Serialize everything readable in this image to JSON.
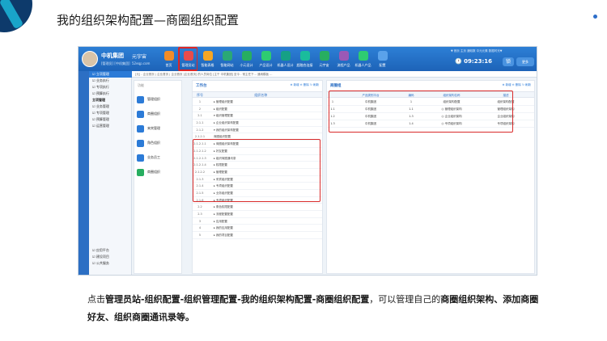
{
  "slide": {
    "title": "我的组织架构配置—商圈组织配置",
    "caption_parts": [
      {
        "text": "点击",
        "bold": false
      },
      {
        "text": "管理员站-组织配置-组织管理配置-我的组织架构配置-商圈组织配置",
        "bold": true
      },
      {
        "text": "，可以管理自己的",
        "bold": false
      },
      {
        "text": "商圈组织架构、添加商圈好友、组织商圈通讯录等。",
        "bold": true
      }
    ]
  },
  "colors": {
    "accent_blue": "#1d63b8",
    "highlight_red": "#d92b2b"
  },
  "app": {
    "org_name": "中机集团",
    "org_sub": "[管理员] [中机集团]",
    "space_name": "元宇宙",
    "space_sub": "52eqp.com",
    "nav": [
      {
        "label": "首页",
        "icon": "home-icon",
        "color": "#f28c28"
      },
      {
        "label": "管理员站",
        "icon": "admin-icon",
        "color": "#e84c4c"
      },
      {
        "label": "智能表格",
        "icon": "table-icon",
        "color": "#f5a623"
      },
      {
        "label": "智能网站",
        "icon": "web-icon",
        "color": "#2aa876"
      },
      {
        "label": "小元设计",
        "icon": "design-icon",
        "color": "#27ae60"
      },
      {
        "label": "产品设计",
        "icon": "product-icon",
        "color": "#2ecc71"
      },
      {
        "label": "机器人设计",
        "icon": "robot-icon",
        "color": "#16a085"
      },
      {
        "label": "超融合连接",
        "icon": "connect-icon",
        "color": "#1abc9c"
      },
      {
        "label": "元宇宙",
        "icon": "meta-icon",
        "color": "#27ae60"
      },
      {
        "label": "流程产品",
        "icon": "flow-icon",
        "color": "#9b59b6"
      },
      {
        "label": "机器人产品",
        "icon": "bot-icon",
        "color": "#2ecc71"
      },
      {
        "label": "配置",
        "icon": "plus-icon",
        "color": "#5aa2ea"
      }
    ],
    "header_links": "▼ 首页  主页  通知数  中元元素  数据时光▼",
    "clock": "09:23:16",
    "lock_label": "锁",
    "more_label": "更多",
    "breadcrumb": "[元] - 企业首页 | 企业首页 | 企业首页 [企业首页] 的人员岗位 [主干 中机集团] 至今 - 常主任下... 通用模板 ...",
    "sidebar": [
      {
        "label": "☑ 立项管理",
        "kind": "sel"
      },
      {
        "label": "☑ 业务执行",
        "kind": "item"
      },
      {
        "label": "☑ 专项执行",
        "kind": "item"
      },
      {
        "label": "☑ 预算执行",
        "kind": "item"
      },
      {
        "label": "立项管理",
        "kind": "grp"
      },
      {
        "label": "☑ 业务管理",
        "kind": "item"
      },
      {
        "label": "☑ 专项管理",
        "kind": "item"
      },
      {
        "label": "☑ 预算管理",
        "kind": "item"
      },
      {
        "label": "☑ 运营管理",
        "kind": "item"
      }
    ],
    "sidebar_bottom": [
      {
        "label": "☑ 应用平台"
      },
      {
        "label": "☑ 建设项目"
      },
      {
        "label": "☑ 公共服务"
      }
    ],
    "function_column": {
      "title": "功能",
      "cards": [
        {
          "label": "管理组织",
          "color": "#2c7bd7"
        },
        {
          "label": "商圈组织",
          "color": "#2c7bd7"
        },
        {
          "label": "来宾管理",
          "color": "#2c7bd7"
        },
        {
          "label": "角色组织",
          "color": "#2c7bd7"
        },
        {
          "label": "业务员工",
          "color": "#2c7bd7"
        },
        {
          "label": "商圈组织",
          "color": "#27ae60"
        }
      ]
    },
    "tree": {
      "title": "工作台",
      "actions": "⊕ 新增  ⊖ 删除  ↻ 刷新",
      "head_no": "序号",
      "head_name": "组织名称",
      "rows": [
        {
          "no": "1",
          "name": "▸ 管理组织配置"
        },
        {
          "no": "2",
          "name": "▸ 组织配置"
        },
        {
          "no": "2.1",
          "name": "▾ 组织管理配置"
        },
        {
          "no": "2.1.1",
          "name": "  ▸ 企业组织架构配置"
        },
        {
          "no": "2.1.2",
          "name": "  ▾ 我的组织架构配置"
        },
        {
          "no": "2.1.2.1",
          "name": "    商圈组织配置"
        },
        {
          "no": "2.1.2.1.1",
          "name": "    ▸ 商圈组织架构配置"
        },
        {
          "no": "2.1.2.1.2",
          "name": "    ▸ 好友配置"
        },
        {
          "no": "2.1.2.1.3",
          "name": "    ▸ 组织商圈通讯录"
        },
        {
          "no": "2.1.2.1.4",
          "name": "    ▸ 权限配置"
        },
        {
          "no": "2.1.2.2",
          "name": "    ▸ 管理配置"
        },
        {
          "no": "2.1.3",
          "name": "  ▸ 来宾组织配置"
        },
        {
          "no": "2.1.4",
          "name": "  ▸ 专项组织配置"
        },
        {
          "no": "2.1.5",
          "name": "  ▸ 业务组织配置"
        },
        {
          "no": "2.1.6",
          "name": "  ▸ 专项组织配置"
        },
        {
          "no": "2.2",
          "name": "▸ 角色权限配置"
        },
        {
          "no": "2.3",
          "name": "▸ 流程配置配置"
        },
        {
          "no": "3",
          "name": "▸ 应用配置"
        },
        {
          "no": "4",
          "name": "▸ 我的应用配置"
        },
        {
          "no": "5",
          "name": "▸ 我的项目配置"
        }
      ]
    },
    "detail": {
      "title": "商圈组",
      "actions": "⊕ 新增   ⊖ 删除   ↻ 刷新",
      "headers": [
        "",
        "",
        "产品类别平台",
        "编码",
        "组织架构名称",
        "描述"
      ],
      "rows": [
        [
          "1",
          "",
          "中机集团",
          "1",
          "组织架构配置",
          "组织架构配置"
        ],
        [
          "1.1",
          "",
          "中机集团",
          "1.1",
          "◎ 管理组织架构",
          "管理组织架构"
        ],
        [
          "1.2",
          "",
          "中机集团",
          "1.3",
          "◎ 企业组织架构",
          "企业组织架构"
        ],
        [
          "1.3",
          "",
          "中机集团",
          "1.4",
          "◎ 专项组织架构",
          "专项组织架构"
        ]
      ]
    }
  }
}
